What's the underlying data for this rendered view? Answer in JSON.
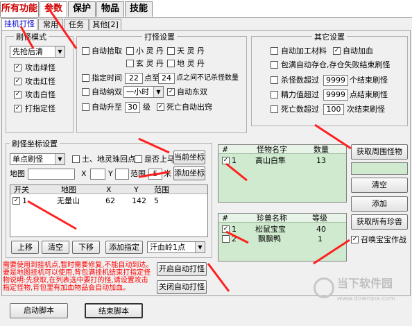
{
  "top_tabs": [
    "所有功能",
    "参数",
    "保护",
    "物品",
    "技能"
  ],
  "sub_tabs": [
    "挂机打怪",
    "常用",
    "任务",
    "其他[2]"
  ],
  "mode_group": {
    "title": "刷怪模式",
    "select_value": "先抢后清",
    "options": [
      {
        "label": "攻击绿怪",
        "checked": true
      },
      {
        "label": "攻击红怪",
        "checked": true
      },
      {
        "label": "攻击白怪",
        "checked": true
      },
      {
        "label": "打指定怪",
        "checked": true
      }
    ]
  },
  "hit_settings": {
    "title": "打怪设置",
    "auto_pickup": "自动拾取",
    "pills": [
      "小 灵 丹",
      "天 灵 丹",
      "玄 灵 丹",
      "地 灵 丹"
    ],
    "specified_time": "指定时间",
    "time_from": "22",
    "time_to_label": "点至",
    "time_to": "24",
    "time_suffix": "点之间不记杀怪数量",
    "auto_double": "自动纳双",
    "double_select": "一小时",
    "auto_east": "自动东双",
    "auto_upgrade": "自动升至",
    "upgrade_level": "30",
    "level_suffix": "级",
    "death_exit": "死亡自动出窍"
  },
  "other_settings": {
    "title": "其它设置",
    "auto_add_material": "自动加工材料",
    "auto_add_blood": "自动加血",
    "bag_full": "包满自动存仓,存仓失败结束刷怪",
    "kill_count_label": "杀怪数超过",
    "kill_count": "9999",
    "kill_suffix": "个结束刷怪",
    "exp_label": "精力值超过",
    "exp_value": "9999",
    "exp_suffix": "点结束刷怪",
    "death_label": "死亡数超过",
    "death_value": "100",
    "death_suffix": "次结束刷怪"
  },
  "coord_group": {
    "title": "刷怪坐标设置",
    "mode_select": "单点刷怪",
    "earth_return": "土、地灵珠回点",
    "is_horse": "是否上马",
    "current_coord_btn": "当前坐标",
    "map_label": "地图",
    "x_label": "X",
    "y_label": "Y",
    "range_label": "范围",
    "range_value": "5",
    "range_unit": "米",
    "add_coord_btn": "添加坐标",
    "table_headers": [
      "开关",
      "地图",
      "X",
      "Y",
      "范围"
    ],
    "rows": [
      {
        "index": "1",
        "map": "无量山",
        "x": "62",
        "y": "142",
        "range": "5",
        "checked": true
      }
    ],
    "btn_up": "上移",
    "btn_clear": "清空",
    "btn_down": "下移",
    "btn_add_route": "添加指定",
    "route_select": "汗血岭1点"
  },
  "monster_list": {
    "headers": [
      "#",
      "怪物名字",
      "数量"
    ],
    "rows": [
      {
        "index": "1",
        "name": "高山白隼",
        "count": "13",
        "checked": true
      }
    ]
  },
  "beast_list": {
    "headers": [
      "#",
      "珍兽名称",
      "等级"
    ],
    "rows": [
      {
        "index": "1",
        "name": "松鼠宝宝",
        "level": "40",
        "checked": true
      },
      {
        "index": "2",
        "name": "飘飘鸭",
        "level": "1",
        "checked": false
      }
    ]
  },
  "right_buttons": {
    "get_monsters": "获取周围怪物",
    "clear": "清空",
    "add": "添加",
    "get_beasts": "获取所有珍兽",
    "summon_label": "召唤宝宝作战"
  },
  "red_note": "需要使用到挂机点,暂时需要修复,不能自动到达。要是地图挂机可以使用,背包满挂机结束打指定怪物说明:先获取,在列表选中要打的怪,请设置攻击指定怪物,背包里有加血物品会自动加血。",
  "auto_hit_btns": {
    "start": "开启自动打怪",
    "stop": "关闭自动打怪"
  },
  "footer": {
    "start_script": "启动脚本",
    "end_script": "结束脚本"
  },
  "watermark": "当下软件园",
  "watermark_sub": "www.downxia.com",
  "colors": {
    "accent_red": "#ff0000",
    "list_bg": "#cfeacf"
  }
}
